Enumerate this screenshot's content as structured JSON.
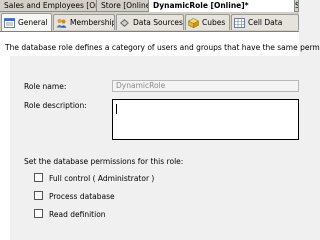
{
  "document_tabs": [
    {
      "label": "Sales and Employees [Online]",
      "active": false
    },
    {
      "label": "Store [Online]*",
      "active": false
    },
    {
      "label": "DynamicRole [Online]*",
      "active": true
    },
    {
      "label": "Sa",
      "active": false
    }
  ],
  "object_tabs": [
    {
      "label": "General",
      "icon": "general-icon",
      "active": true
    },
    {
      "label": "Membership",
      "icon": "membership-icon",
      "active": false
    },
    {
      "label": "Data Sources",
      "icon": "data-sources-icon",
      "active": false
    },
    {
      "label": "Cubes",
      "icon": "cubes-icon",
      "active": false
    },
    {
      "label": "Cell Data",
      "icon": "cell-data-icon",
      "active": false
    }
  ],
  "general": {
    "description": "The database role defines a category of users and groups that have the same permi",
    "role_name_label": "Role name:",
    "role_name_value": "DynamicRole",
    "role_description_label": "Role description:",
    "role_description_value": "",
    "permissions_heading": "Set the database permissions for this role:",
    "permissions": [
      {
        "label": "Full control ( Administrator )",
        "checked": false
      },
      {
        "label": "Process database",
        "checked": false
      },
      {
        "label": "Read definition",
        "checked": false
      }
    ]
  }
}
